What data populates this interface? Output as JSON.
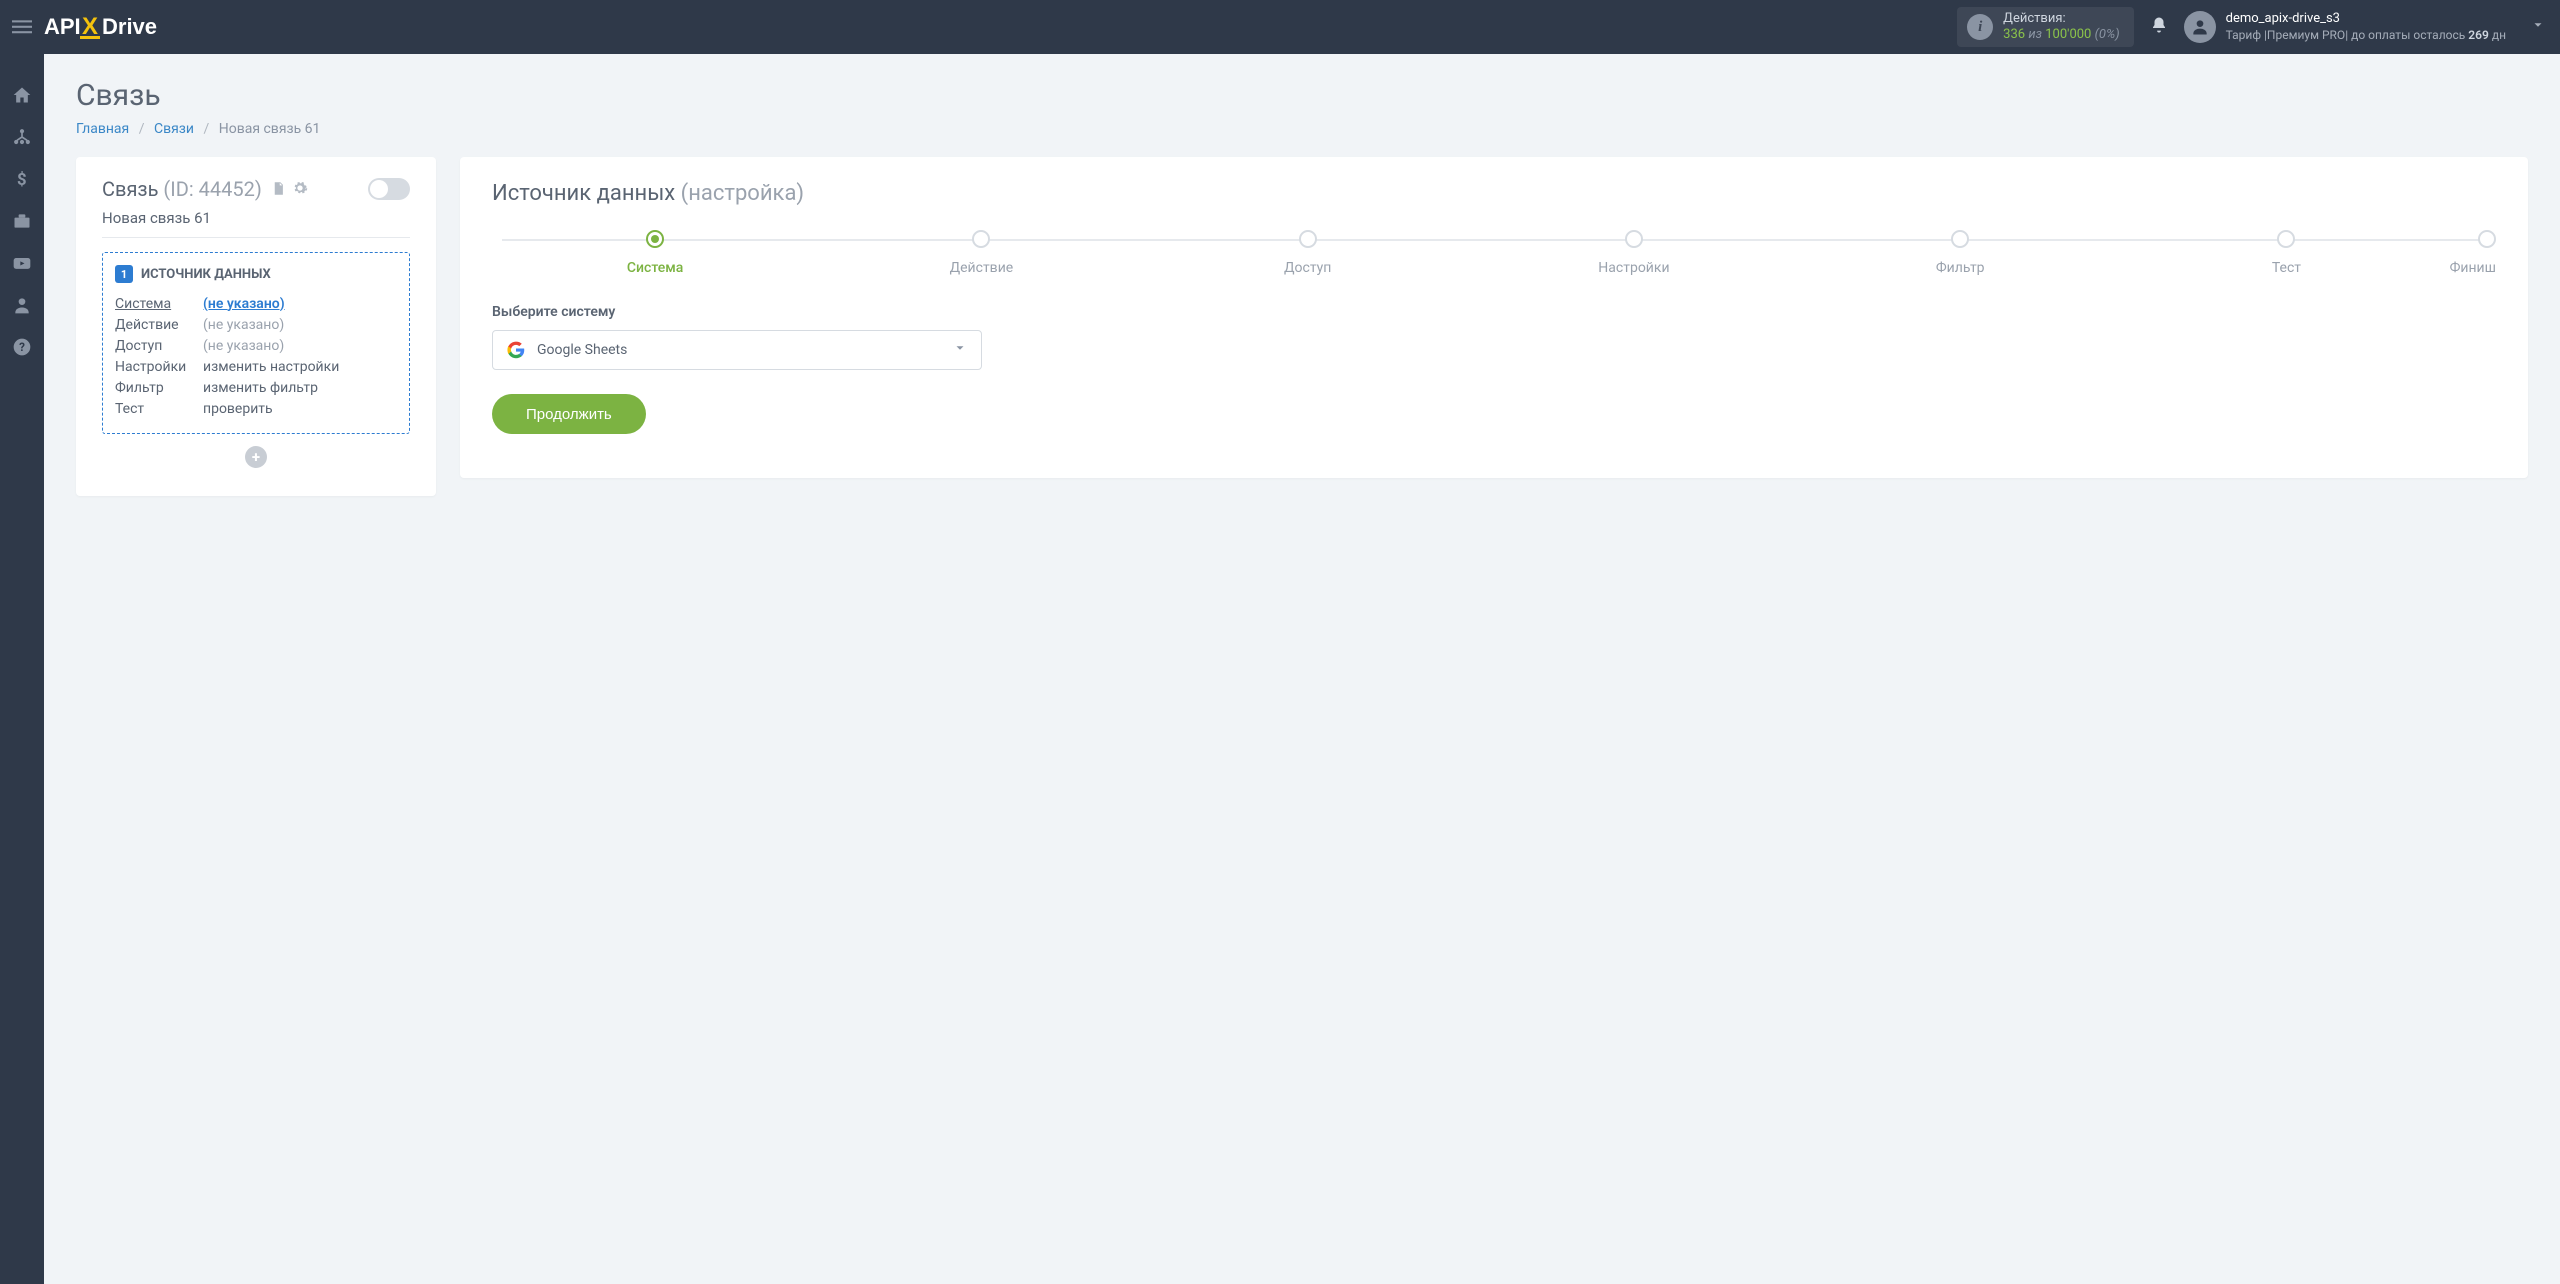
{
  "header": {
    "actions": {
      "label": "Действия:",
      "count": "336",
      "of": "из",
      "total": "100'000",
      "percent": "(0%)"
    },
    "user": {
      "name": "demo_apix-drive_s3",
      "tariff_prefix": "Тариф |Премиум PRO| до оплаты осталось",
      "days": "269",
      "days_suffix": "дн"
    }
  },
  "page": {
    "title": "Связь"
  },
  "breadcrumbs": {
    "home": "Главная",
    "connections": "Связи",
    "current": "Новая связь 61"
  },
  "left": {
    "title_label": "Связь",
    "title_id": "(ID: 44452)",
    "connection_name": "Новая связь 61",
    "source_box": {
      "badge": "1",
      "title": "ИСТОЧНИК ДАННЫХ",
      "rows": {
        "system_label": "Система",
        "system_value": "(не указано)",
        "action_label": "Действие",
        "action_value": "(не указано)",
        "access_label": "Доступ",
        "access_value": "(не указано)",
        "settings_label": "Настройки",
        "settings_value": "изменить настройки",
        "filter_label": "Фильтр",
        "filter_value": "изменить фильтр",
        "test_label": "Тест",
        "test_value": "проверить"
      }
    }
  },
  "right": {
    "title_main": "Источник данных",
    "title_muted": "(настройка)",
    "steps": {
      "system": "Система",
      "action": "Действие",
      "access": "Доступ",
      "settings": "Настройки",
      "filter": "Фильтр",
      "test": "Тест",
      "finish": "Финиш"
    },
    "field_label": "Выберите систему",
    "selected_system": "Google Sheets",
    "continue": "Продолжить"
  }
}
